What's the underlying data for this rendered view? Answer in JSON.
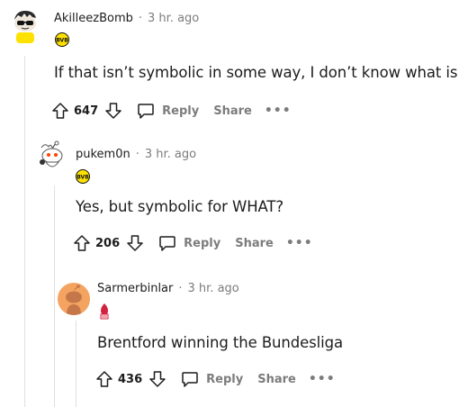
{
  "comments": [
    {
      "author": "AkilleezBomb",
      "separator": "·",
      "time": "3 hr. ago",
      "flair_icon": "bvb-flair-icon",
      "body": "If that isn’t symbolic in some way, I don’t know what is",
      "score": "647",
      "reply_label": "Reply",
      "share_label": "Share",
      "more_label": "•••"
    },
    {
      "author": "pukem0n",
      "separator": "·",
      "time": "3 hr. ago",
      "flair_icon": "bvb-flair-icon",
      "body": "Yes, but symbolic for WHAT?",
      "score": "206",
      "reply_label": "Reply",
      "share_label": "Share",
      "more_label": "•••"
    },
    {
      "author": "Sarmerbinlar",
      "separator": "·",
      "time": "3 hr. ago",
      "flair_icon": "club-crest-flair-icon",
      "body": "Brentford winning the Bundesliga",
      "score": "436",
      "reply_label": "Reply",
      "share_label": "Share",
      "more_label": "•••"
    }
  ],
  "colors": {
    "bvb_yellow": "#fde100",
    "muted_text": "#7c7c7c",
    "thread_line": "#e0e0e0",
    "crest_red": "#d4213d",
    "avatar_orange": "#f4a460"
  }
}
